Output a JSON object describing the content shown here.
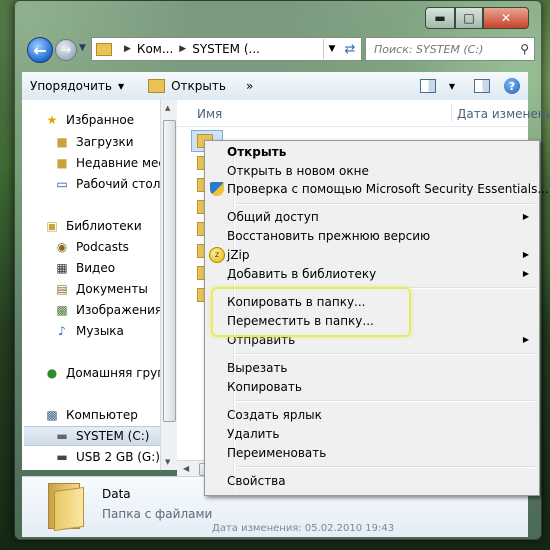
{
  "address": {
    "crumbs": [
      "Ком...",
      "SYSTEM (..."
    ]
  },
  "search": {
    "placeholder": "Поиск: SYSTEM (C:)"
  },
  "toolbar": {
    "organize": "Упорядочить",
    "open": "Открыть",
    "more": "»"
  },
  "sidebar": {
    "favorites": "Избранное",
    "downloads": "Загрузки",
    "recent": "Недавние места",
    "desktop": "Рабочий стол",
    "libraries": "Библиотеки",
    "podcasts": "Podcasts",
    "video": "Видео",
    "documents": "Документы",
    "images": "Изображения",
    "music": "Музыка",
    "homegroup": "Домашняя группа",
    "computer": "Компьютер",
    "system_c": "SYSTEM (C:)",
    "usb": "USB 2 GB (G:)"
  },
  "columns": {
    "name": "Имя",
    "date": "Дата изменения"
  },
  "details": {
    "name": "Data",
    "type": "Папка с файлами",
    "modified": "Дата изменения: 05.02.2010 19:43"
  },
  "context_menu": {
    "open": "Открыть",
    "open_new_window": "Открыть в новом окне",
    "scan_mse": "Проверка с помощью Microsoft Security Essentials...",
    "share": "Общий доступ",
    "restore": "Восстановить прежнюю версию",
    "jzip": "jZip",
    "add_library": "Добавить в библиотеку",
    "copy_to": "Копировать в папку...",
    "move_to": "Переместить в папку...",
    "send_to": "Отправить",
    "cut": "Вырезать",
    "copy": "Копировать",
    "shortcut": "Создать ярлык",
    "delete": "Удалить",
    "rename": "Переименовать",
    "properties": "Свойства"
  }
}
